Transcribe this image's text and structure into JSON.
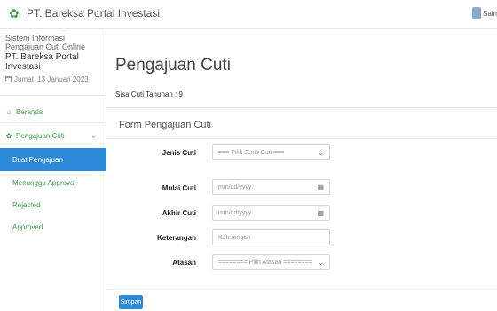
{
  "header": {
    "brand": "PT. Bareksa Portal Investasi",
    "user_name": "Salm"
  },
  "sidebar": {
    "system_title": "Sistem Informasi Pengajuan Cuti Online",
    "organization": "PT. Bareksa Portal Investasi",
    "date": "Jumat, 13 Januari 2023",
    "menu": {
      "home": "Beranda",
      "leave": "Pengajuan Cuti",
      "sub": [
        "Buat Pengajuan",
        "Menunggu Approval",
        "Rejected",
        "Approved"
      ]
    }
  },
  "main": {
    "title": "Pengajuan Cuti",
    "remaining_label": "Sisa Cuti Tahunan : 9",
    "form": {
      "title": "Form Pengajuan Cuti",
      "leave_type_label": "Jenis Cuti",
      "leave_type_value": "=== Pilih Jenis Cuti ===",
      "start_label": "Mulai Cuti",
      "start_placeholder": "mm/dd/yyyy",
      "end_label": "Akhir Cuti",
      "end_placeholder": "mm/dd/yyyy",
      "note_label": "Keterangan",
      "note_placeholder": "Keterangan",
      "supervisor_label": "Atasan",
      "supervisor_value": "======== Pilih Atasan ========",
      "submit": "Simpan"
    }
  }
}
